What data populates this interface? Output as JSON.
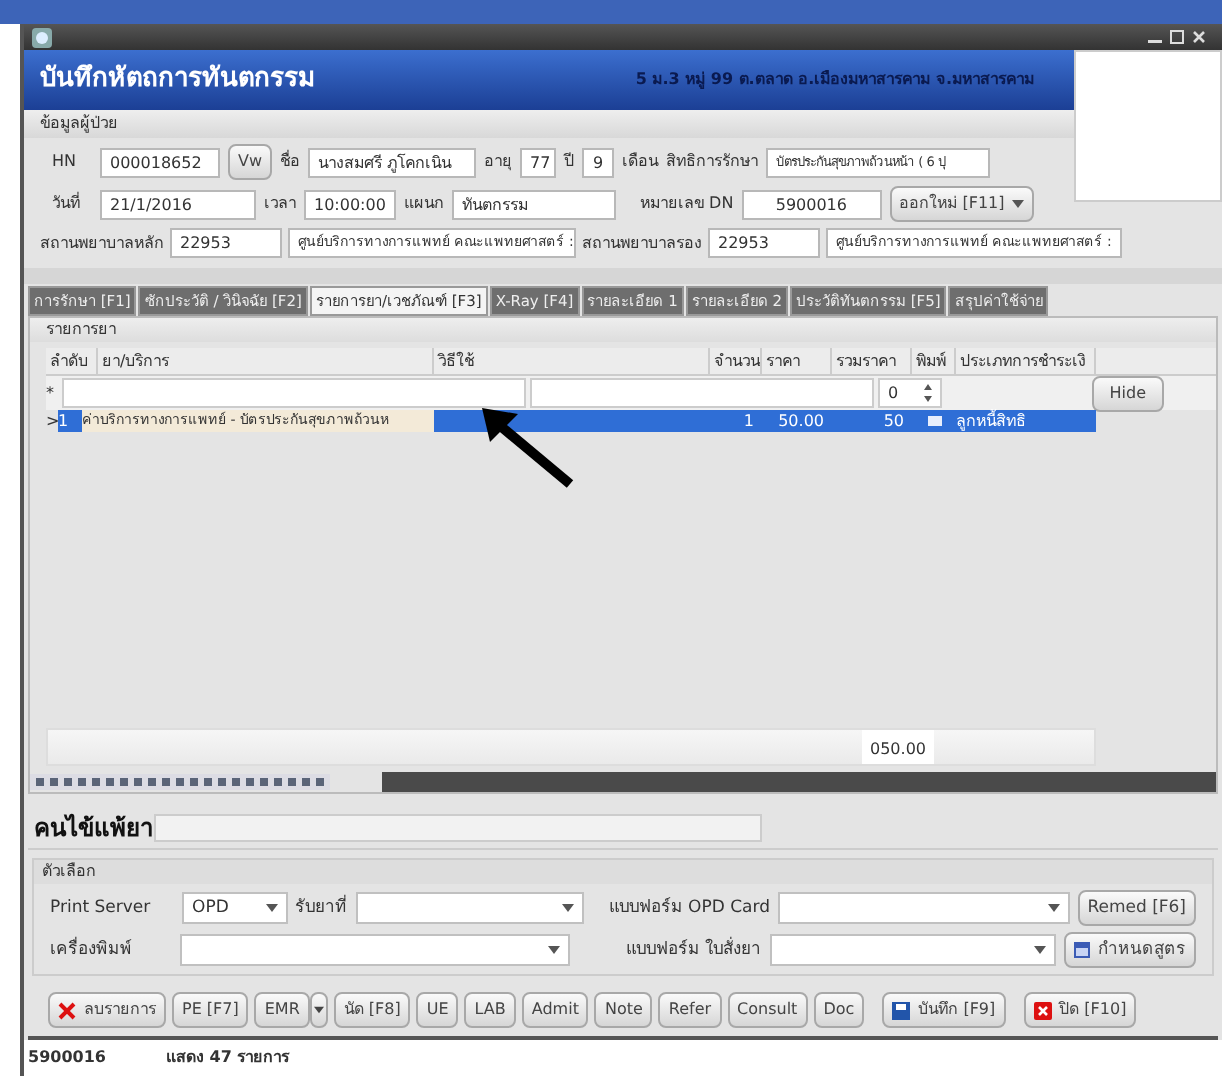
{
  "window": {
    "title": "บันทึกหัตถการทันตกรรม",
    "address": "5 ม.3 หมู่ 99 ต.ตลาด อ.เมืองมหาสารคาม จ.มหาสารคาม"
  },
  "patient": {
    "section": "ข้อมูลผู้ป่วย",
    "hn_label": "HN",
    "hn": "000018652",
    "view_button": "Vw",
    "name_label": "ชื่อ",
    "name": "นางสมศรี ภูโคกเนิน",
    "age_label": "อายุ",
    "age_years": "77",
    "years_label": "ปี",
    "age_months": "9",
    "months_label": "เดือน",
    "right_label": "สิทธิการรักษา",
    "right": "บัตรประกันสุขภาพถ้วนหน้า ( 6 ปุ",
    "date_label": "วันที่",
    "date": "21/1/2016",
    "time_label": "เวลา",
    "time": "10:00:00",
    "dept_label": "แผนก",
    "dept": "ทันตกรรม",
    "dn_label": "หมายเลข DN",
    "dn": "5900016",
    "new_button": "ออกใหม่ [F11]",
    "main_hosp_label": "สถานพยาบาลหลัก",
    "main_hosp_code": "22953",
    "main_hosp_name": "ศูนย์บริการทางการแพทย์ คณะแพทยศาสตร์ :",
    "sub_hosp_label": "สถานพยาบาลรอง",
    "sub_hosp_code": "22953",
    "sub_hosp_name": "ศูนย์บริการทางการแพทย์ คณะแพทยศาสตร์ :"
  },
  "tabs": [
    {
      "label": "การรักษา [F1]",
      "selected": false
    },
    {
      "label": "ซักประวัติ / วินิจฉัย [F2]",
      "selected": false
    },
    {
      "label": "รายการยา/เวชภัณฑ์ [F3]",
      "selected": true
    },
    {
      "label": "X-Ray [F4]",
      "selected": false
    },
    {
      "label": "รายละเอียด 1",
      "selected": false
    },
    {
      "label": "รายละเอียด 2",
      "selected": false
    },
    {
      "label": "ประวัติทันตกรรม [F5]",
      "selected": false
    },
    {
      "label": "สรุปค่าใช้จ่าย",
      "selected": false
    }
  ],
  "drug_list": {
    "title": "รายการยา",
    "columns": [
      "ลำดับ",
      "ยา/บริการ",
      "วิธีใช้",
      "จำนวน",
      "ราคา",
      "รวมราคา",
      "พิมพ์",
      "ประเภทการชำระเงิ"
    ],
    "new_row": {
      "marker": "*",
      "quantity": "0"
    },
    "hide_button": "Hide",
    "rows": [
      {
        "marker": ">",
        "no": "1",
        "item": "ค่าบริการทางการแพทย์ - บัตรประกันสุขภาพถ้วนห",
        "quantity": "1",
        "price": "50.00",
        "total": "50",
        "payment": "ลูกหนี้สิทธิ",
        "selected": true
      }
    ],
    "sum": "050.00"
  },
  "allergy": {
    "label": "คนไข้แพ้ยา"
  },
  "options": {
    "title": "ตัวเลือก",
    "print_server_label": "Print Server",
    "print_server": "OPD",
    "pickup_label": "รับยาที่",
    "opd_form_label": "แบบฟอร์ม OPD Card",
    "remed_button": "Remed [F6]",
    "printer_label": "เครื่องพิมพ์",
    "rx_form_label": "แบบฟอร์ม ใบสั่งยา",
    "formula_button": "กำหนดสูตร"
  },
  "actions": [
    {
      "label": "ลบรายการ",
      "kind": "delete"
    },
    {
      "label": "PE [F7]",
      "kind": "plain"
    },
    {
      "label": "EMR",
      "kind": "split"
    },
    {
      "label": "นัด [F8]",
      "kind": "plain"
    },
    {
      "label": "UE",
      "kind": "plain"
    },
    {
      "label": "LAB",
      "kind": "plain"
    },
    {
      "label": "Admit",
      "kind": "plain"
    },
    {
      "label": "Note",
      "kind": "plain"
    },
    {
      "label": "Refer",
      "kind": "plain"
    },
    {
      "label": "Consult",
      "kind": "plain"
    },
    {
      "label": "Doc",
      "kind": "plain"
    },
    {
      "label": "บันทึก [F9]",
      "kind": "save"
    },
    {
      "label": "ปิด [F10]",
      "kind": "close"
    }
  ],
  "status_bar": {
    "dn": "5900016",
    "count": "แสดง 47 รายการ"
  }
}
